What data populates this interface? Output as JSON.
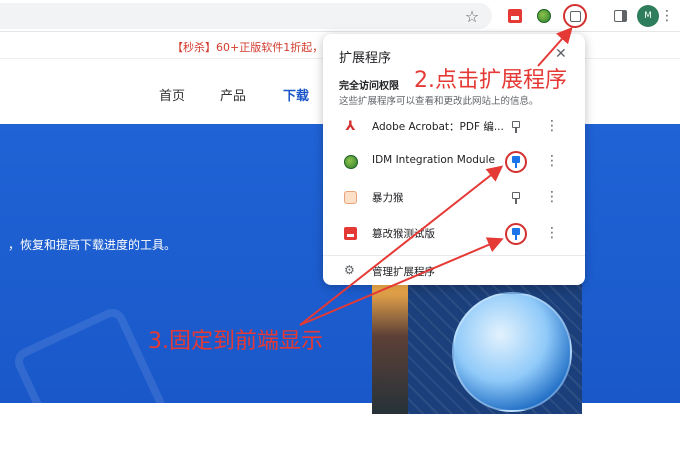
{
  "toolbar": {
    "icons": [
      "star-icon",
      "ext-red-icon",
      "idm-icon",
      "extensions-puzzle-icon",
      "side-panel-icon",
      "avatar",
      "menu-icon"
    ],
    "avatar_text": "M"
  },
  "promo": {
    "text": "【秒杀】60+正版软件1折起，今日"
  },
  "site_nav": {
    "items": [
      "首页",
      "产品",
      "下载"
    ]
  },
  "hero": {
    "tagline": "，恢复和提高下载进度的工具。"
  },
  "popup": {
    "title": "扩展程序",
    "section_title": "完全访问权限",
    "section_desc": "这些扩展程序可以查看和更改此网站上的信息。",
    "extensions": [
      {
        "name": "Adobe Acrobat：PDF 编...",
        "icon": "acrobat-icon",
        "pinned": false
      },
      {
        "name": "IDM Integration Module",
        "icon": "idm-icon",
        "pinned": true
      },
      {
        "name": "暴力猴",
        "icon": "violentmonkey-icon",
        "pinned": false
      },
      {
        "name": "篡改猴测试版",
        "icon": "tampermonkey-icon",
        "pinned": true
      }
    ],
    "manage_label": "管理扩展程序"
  },
  "annotations": {
    "step2": "2.点击扩展程序",
    "step3": "3.固定到前端显示",
    "color": "#e53935"
  }
}
